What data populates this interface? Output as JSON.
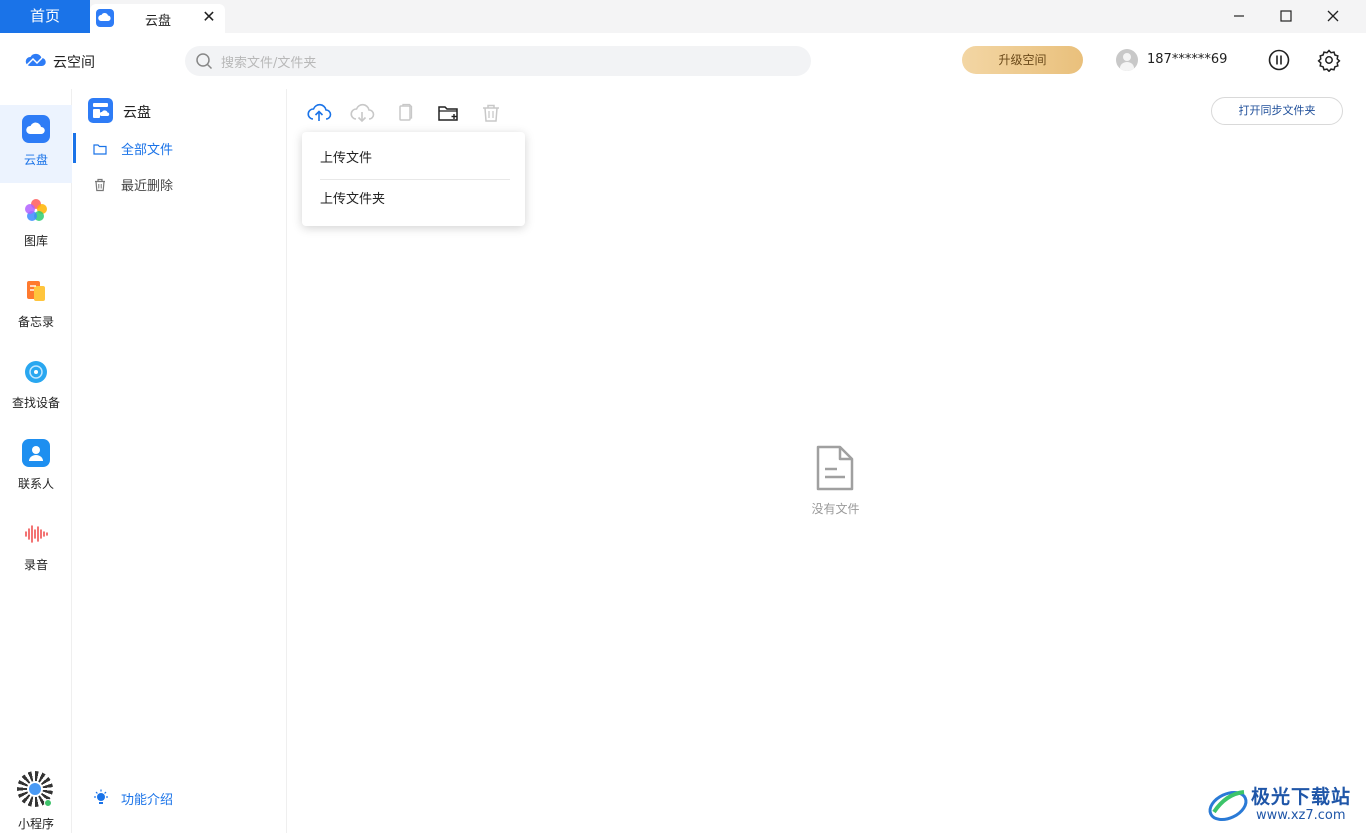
{
  "titlebar": {
    "home_tab": "首页",
    "active_tab": "云盘",
    "close_tab": "✕",
    "minimize": "—",
    "maximize": "☐",
    "close": "✕"
  },
  "header": {
    "app_name": "云空间",
    "search_placeholder": "搜索文件/文件夹",
    "upgrade_label": "升级空间",
    "username": "187******69"
  },
  "leftnav": {
    "items": [
      {
        "label": "云盘",
        "icon": "cloud-drive-icon",
        "active": true
      },
      {
        "label": "图库",
        "icon": "gallery-icon"
      },
      {
        "label": "备忘录",
        "icon": "notes-icon"
      },
      {
        "label": "查找设备",
        "icon": "find-device-icon"
      },
      {
        "label": "联系人",
        "icon": "contacts-icon"
      },
      {
        "label": "录音",
        "icon": "recorder-icon"
      }
    ],
    "mini_program": "小程序"
  },
  "sidebar": {
    "title": "云盘",
    "items": [
      {
        "label": "全部文件",
        "icon": "folder-icon",
        "active": true
      },
      {
        "label": "最近删除",
        "icon": "trash-icon"
      }
    ],
    "feature_intro": "功能介绍"
  },
  "toolbar": {
    "sync_folder_label": "打开同步文件夹",
    "upload_menu": [
      "上传文件",
      "上传文件夹"
    ]
  },
  "content": {
    "empty_text": "没有文件"
  },
  "watermark": {
    "title": "极光下载站",
    "url": "www.xz7.com"
  },
  "colors": {
    "accent": "#1a73e8",
    "upgrade_gold": "#e9c07c"
  }
}
